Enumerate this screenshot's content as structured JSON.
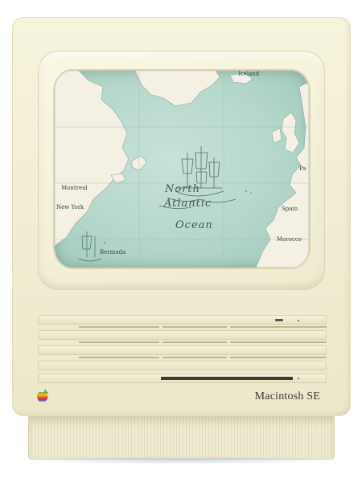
{
  "device": {
    "brand_label": "Macintosh SE",
    "logo_icon": "apple-rainbow-icon"
  },
  "screen": {
    "wallpaper": "north-atlantic-map",
    "ocean_label_line1": "North",
    "ocean_label_line2": "Atlantic",
    "ocean_label_line3": "Ocean",
    "places": {
      "iceland": "Iceland",
      "montreal": "Montreal",
      "new_york": "New York",
      "paris": "Pa",
      "spain": "Spain",
      "morocco": "Morocco",
      "bermuda": "Bermuda"
    },
    "ship_icon": "sailing-ship-icon",
    "colors": {
      "sea": "#b5d7cb",
      "land": "#f4f1e4",
      "ink": "#2f4a44"
    }
  },
  "colors": {
    "case": "#f3efd5",
    "slot": "#3c3b34"
  }
}
